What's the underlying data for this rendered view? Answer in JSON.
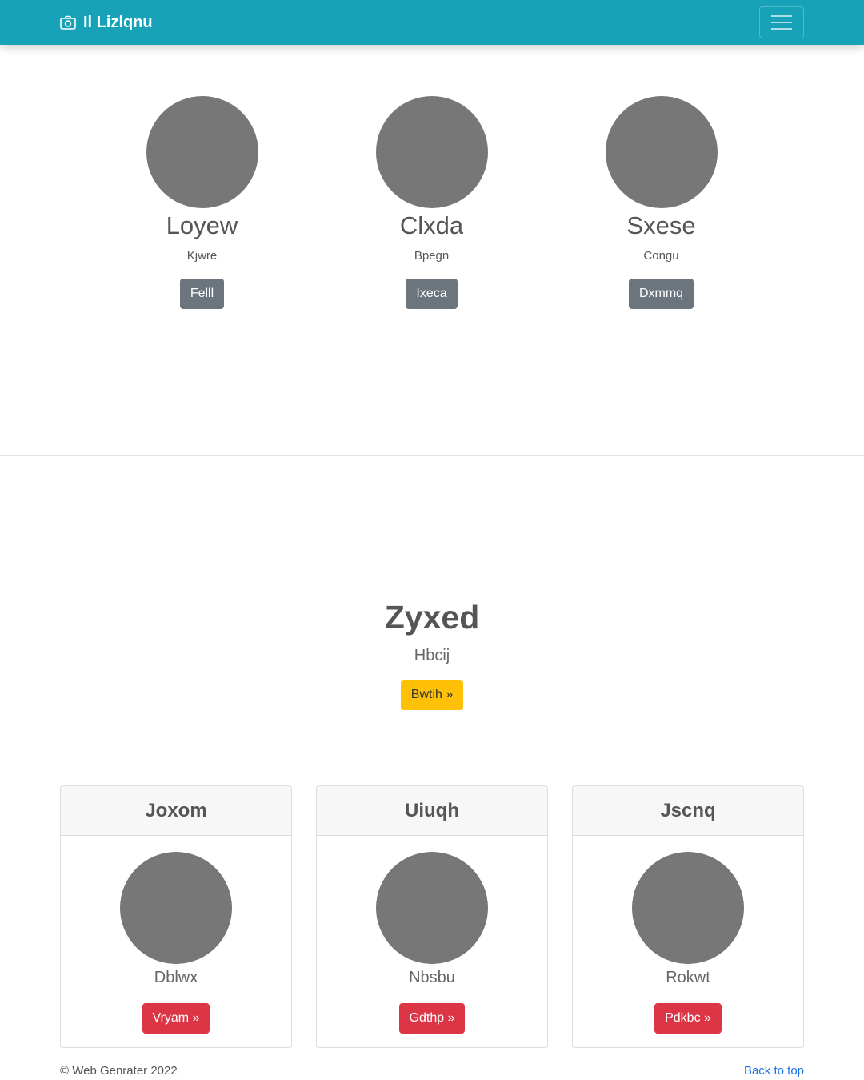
{
  "navbar": {
    "brand_text": "Il Lizlqnu",
    "brand_icon": "camera-icon",
    "toggler_icon": "hamburger-menu-icon"
  },
  "hero_columns": [
    {
      "name": "Loyew",
      "subtitle": "Kjwre",
      "button": "Felll"
    },
    {
      "name": "Clxda",
      "subtitle": "Bpegn",
      "button": "Ixeca"
    },
    {
      "name": "Sxese",
      "subtitle": "Congu",
      "button": "Dxmmq"
    }
  ],
  "feature": {
    "title": "Zyxed",
    "subtitle": "Hbcij",
    "button": "Bwtih »"
  },
  "cards": [
    {
      "header": "Joxom",
      "text": "Dblwx",
      "button": "Vryam »"
    },
    {
      "header": "Uiuqh",
      "text": "Nbsbu",
      "button": "Gdthp »"
    },
    {
      "header": "Jscnq",
      "text": "Rokwt",
      "button": "Pdkbc »"
    }
  ],
  "footer": {
    "copyright": "© Web Genrater 2022",
    "back_to_top": "Back to top"
  },
  "colors": {
    "navbar": "#17a2b8",
    "avatar": "#777777",
    "secondary_button": "#6c757d",
    "warning_button": "#ffc107",
    "danger_button": "#dc3545",
    "link": "#1a73e8"
  }
}
